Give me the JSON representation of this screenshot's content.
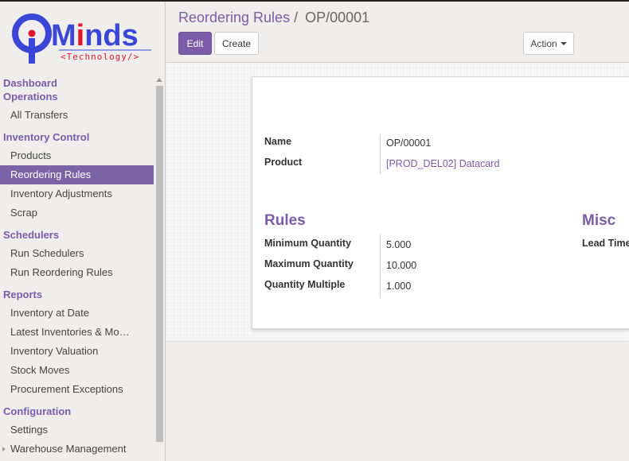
{
  "brand": {
    "name_prefix": "M",
    "name_i": "i",
    "name_suffix": "nds",
    "tagline": "<Technology/>",
    "colors": {
      "blue": "#3a46d6",
      "red": "#e0182b"
    }
  },
  "sidebar": {
    "sections": [
      {
        "header": "Dashboard",
        "items": []
      },
      {
        "header": "Operations",
        "items": [
          {
            "label": "All Transfers"
          }
        ]
      },
      {
        "header": "Inventory Control",
        "items": [
          {
            "label": "Products"
          },
          {
            "label": "Reordering Rules",
            "active": true
          },
          {
            "label": "Inventory Adjustments"
          },
          {
            "label": "Scrap"
          }
        ]
      },
      {
        "header": "Schedulers",
        "items": [
          {
            "label": "Run Schedulers"
          },
          {
            "label": "Run Reordering Rules"
          }
        ]
      },
      {
        "header": "Reports",
        "items": [
          {
            "label": "Inventory at Date"
          },
          {
            "label": "Latest Inventories & Mo…"
          },
          {
            "label": "Inventory Valuation"
          },
          {
            "label": "Stock Moves"
          },
          {
            "label": "Procurement Exceptions"
          }
        ]
      },
      {
        "header": "Configuration",
        "items": [
          {
            "label": "Settings"
          },
          {
            "label": "Warehouse Management",
            "expandable": true
          }
        ]
      }
    ]
  },
  "breadcrumb": {
    "parent": "Reordering Rules",
    "separator": "/",
    "current": "OP/00001"
  },
  "toolbar": {
    "edit_label": "Edit",
    "create_label": "Create",
    "action_label": "Action"
  },
  "form": {
    "name_label": "Name",
    "name_value": "OP/00001",
    "product_label": "Product",
    "product_value": "[PROD_DEL02] Datacard",
    "rules_title": "Rules",
    "min_label": "Minimum Quantity",
    "min_value": "5.000",
    "max_label": "Maximum Quantity",
    "max_value": "10.000",
    "mult_label": "Quantity Multiple",
    "mult_value": "1.000",
    "misc_title": "Misc",
    "lead_label": "Lead Time"
  },
  "theme": {
    "accent": "#7c5ba8",
    "active_bg": "#7c63a8"
  }
}
